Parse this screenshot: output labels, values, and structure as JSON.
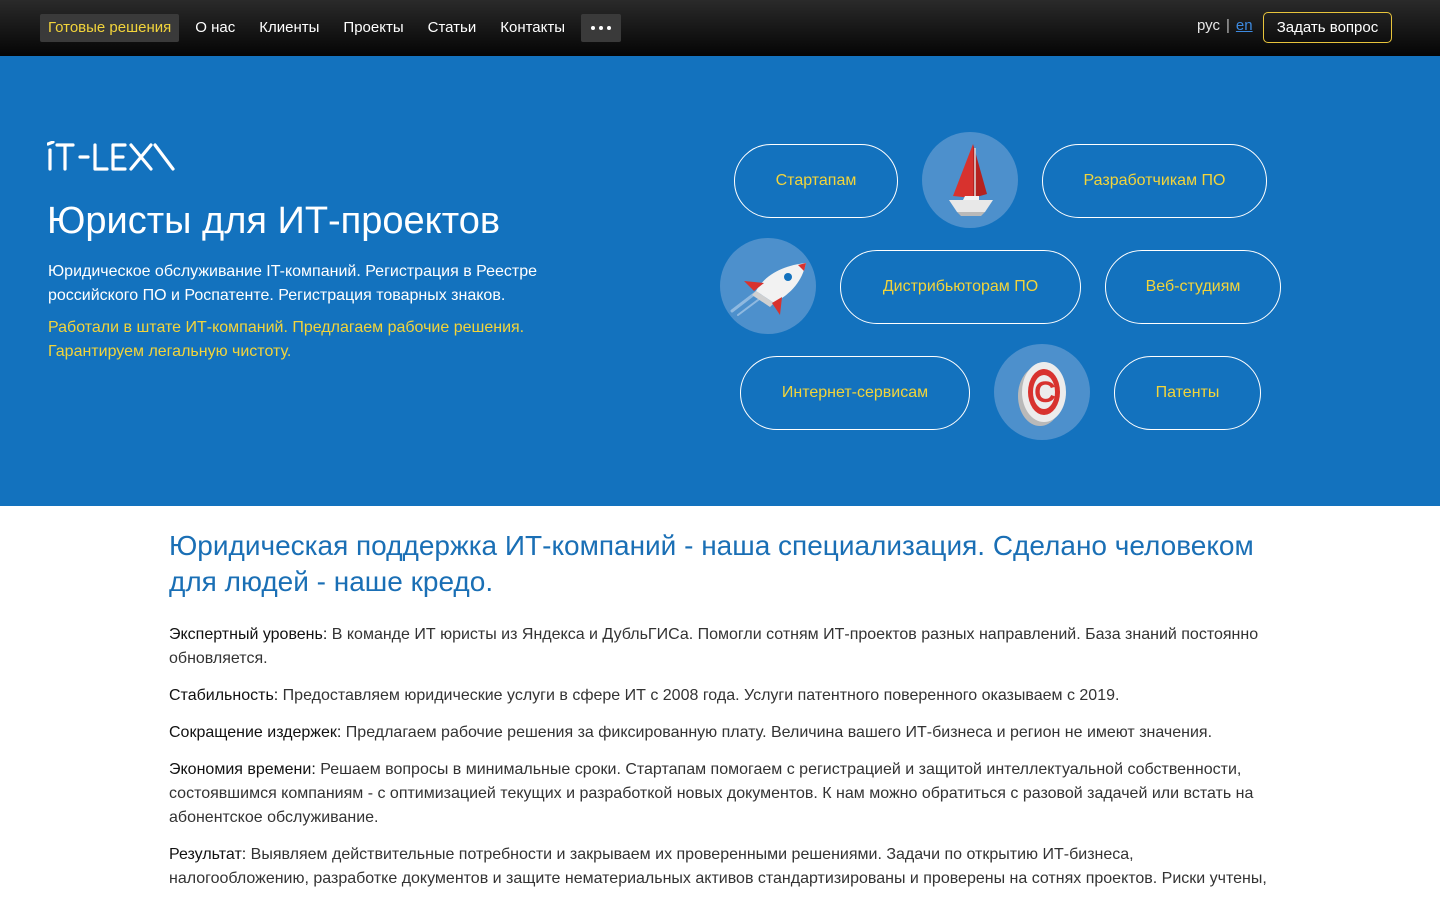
{
  "nav": {
    "items": [
      {
        "label": "Готовые решения",
        "active": true
      },
      {
        "label": "О нас"
      },
      {
        "label": "Клиенты"
      },
      {
        "label": "Проекты"
      },
      {
        "label": "Статьи"
      },
      {
        "label": "Контакты"
      }
    ],
    "lang_ru": "рус",
    "lang_sep": "|",
    "lang_en": "en",
    "ask_button": "Задать вопрос"
  },
  "hero": {
    "logo_text": "IT-LEX",
    "title": "Юристы для ИТ-проектов",
    "description": "Юридическое обслуживание IT-компаний. Регистрация в Реестре российского ПО и Роспатенте. Регистрация товарных знаков.",
    "accent": "Работали в штате ИТ-компаний. Предлагаем рабочие решения. Гарантируем легальную чистоту.",
    "pills": {
      "startups": "Стартапам",
      "developers": "Разработчикам ПО",
      "distributors": "Дистрибьюторам ПО",
      "webstudios": "Веб-студиям",
      "internet": "Интернет-сервисам",
      "patents": "Патенты"
    }
  },
  "content": {
    "title": "Юридическая поддержка ИТ-компаний - наша специализация. Сделано человеком для людей - наше кредо.",
    "paragraphs": [
      {
        "label": "Экспертный уровень:",
        "text": " В команде ИТ юристы из Яндекса и ДубльГИСа. Помогли сотням ИТ-проектов разных направлений. База знаний постоянно обновляется."
      },
      {
        "label": "Стабильность:",
        "text": " Предоставляем юридические услуги в сфере ИТ с 2008 года. Услуги патентного поверенного оказываем с 2019."
      },
      {
        "label": "Сокращение издержек:",
        "text": " Предлагаем рабочие решения за фиксированную плату. Величина вашего ИТ-бизнеса и регион не имеют значения."
      },
      {
        "label": "Экономия времени:",
        "text": " Решаем вопросы в минимальные сроки. Стартапам помогаем с регистрацией и защитой интеллектуальной собственности, состоявшимся компаниям - с оптимизацией текущих и разработкой новых документов. К нам можно обратиться с разовой задачей или встать на абонентское обслуживание."
      },
      {
        "label": "Результат:",
        "text": " Выявляем действительные потребности и закрываем их проверенными решениями. Задачи по открытию ИТ-бизнеса, налогообложению, разработке документов и защите нематериальных активов стандартизированы и проверены на сотнях проектов. Риски учтены,"
      }
    ]
  },
  "colors": {
    "hero_bg": "#1372be",
    "accent_yellow": "#f2d43b",
    "title_blue": "#1a6fb5"
  }
}
